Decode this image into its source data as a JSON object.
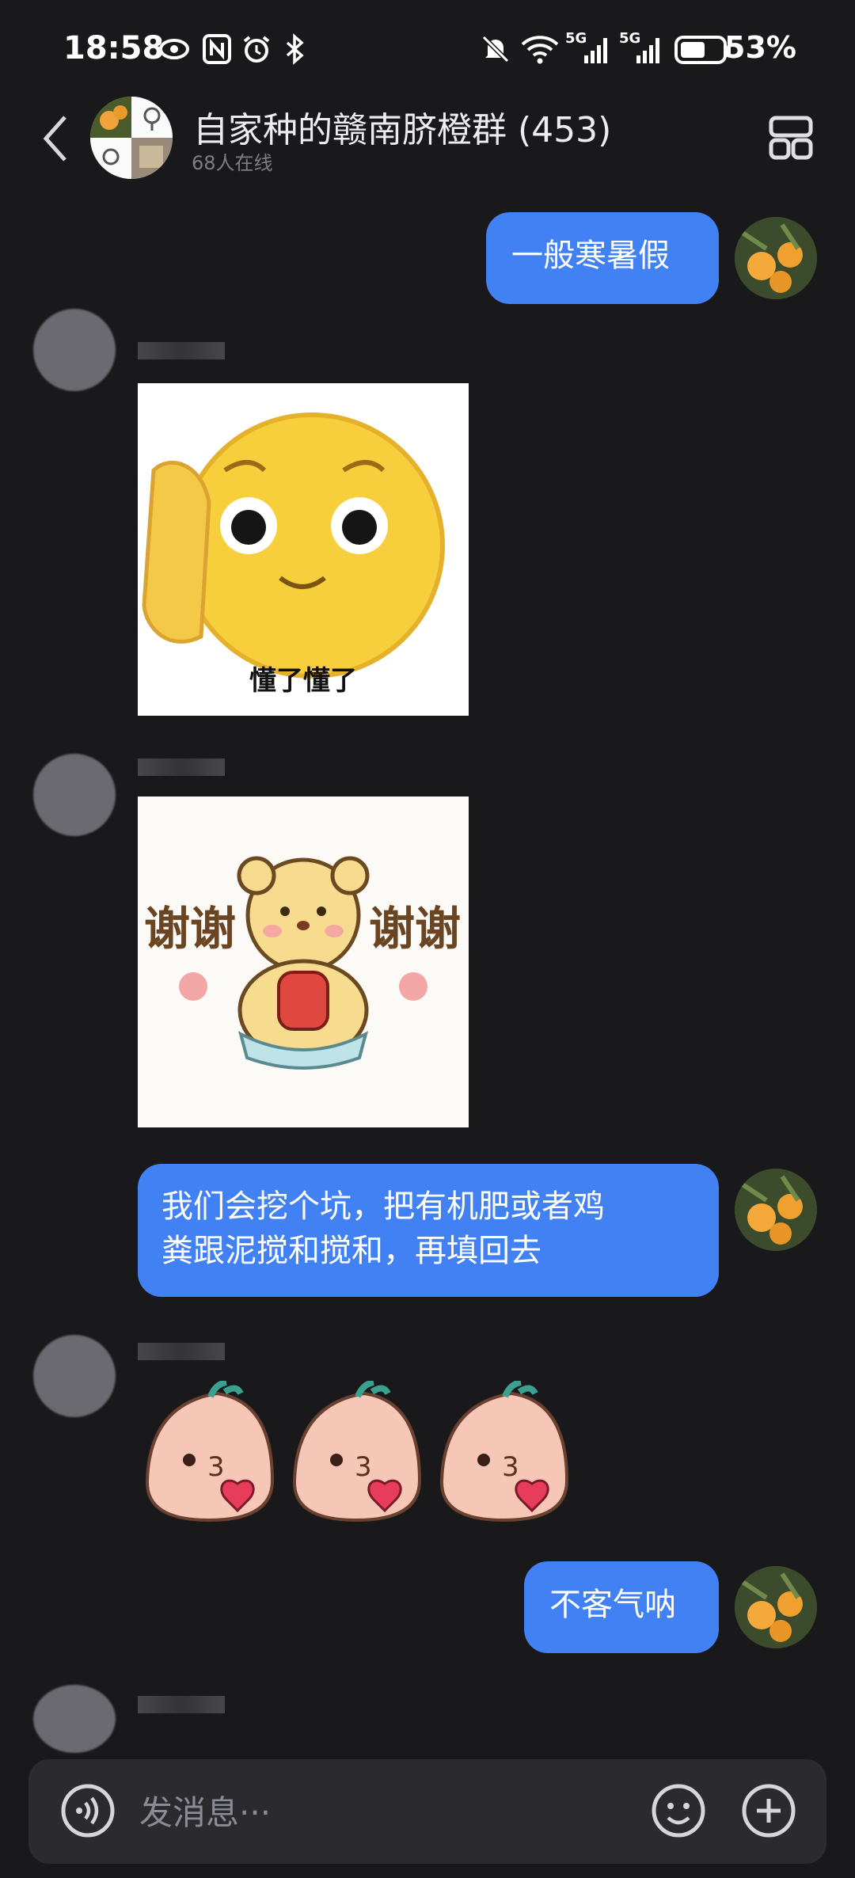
{
  "status_bar": {
    "time": "18:58",
    "battery_percent": "53%",
    "network": [
      "5G",
      "5G"
    ]
  },
  "header": {
    "title": "自家种的赣南脐橙群 (453)",
    "subtitle": "68人在线"
  },
  "messages": [
    {
      "sender": "me",
      "type": "text",
      "text": "一般寒暑假"
    },
    {
      "sender": "other",
      "type": "sticker",
      "caption": "懂了懂了"
    },
    {
      "sender": "other",
      "type": "sticker",
      "caption": "谢谢"
    },
    {
      "sender": "me",
      "type": "text",
      "text": "我们会挖个坑，把有机肥或者鸡\n粪跟泥搅和搅和，再填回去"
    },
    {
      "sender": "other",
      "type": "emoji",
      "count": 3
    },
    {
      "sender": "me",
      "type": "text",
      "text": "不客气呐"
    }
  ],
  "input": {
    "placeholder": "发消息···"
  },
  "colors": {
    "background": "#19191c",
    "bubble_mine": "#4281f4"
  }
}
